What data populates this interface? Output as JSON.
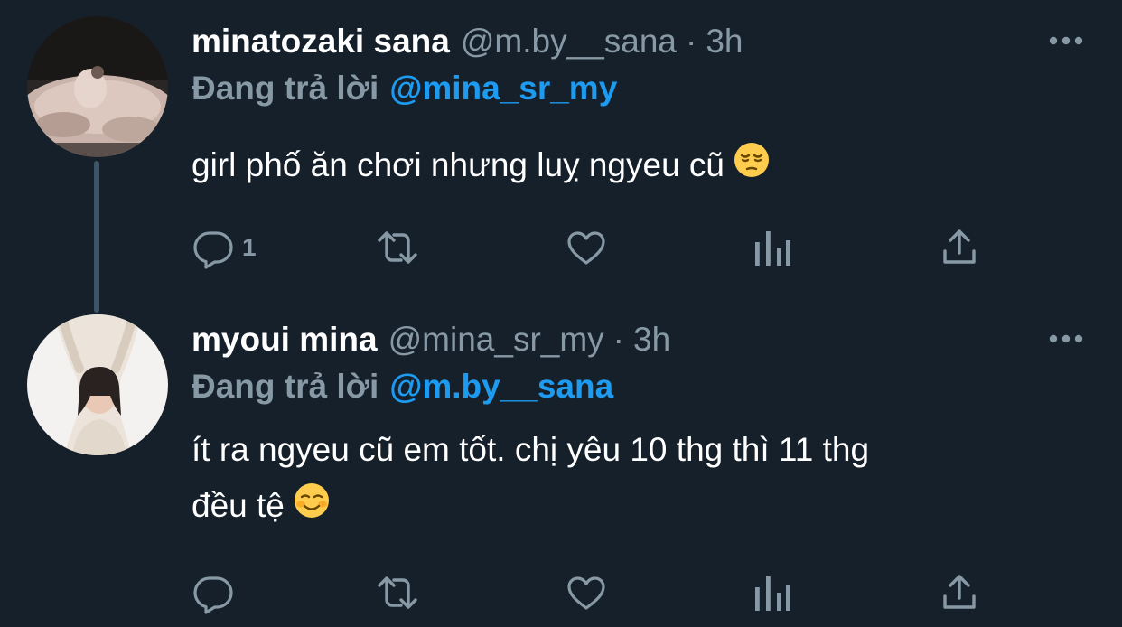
{
  "tweets": [
    {
      "display_name": "minatozaki sana",
      "handle": "@m.by__sana",
      "separator": "·",
      "time": "3h",
      "reply_prefix": "Đang trả lời",
      "reply_mention": "@mina_sr_my",
      "text": "girl phố ăn chơi nhưng luỵ ngyeu cũ",
      "emoji": "pensive-face",
      "reply_count": "1",
      "avatar": "photo-woman-in-ballgown"
    },
    {
      "display_name": "myoui mina",
      "handle": "@mina_sr_my",
      "separator": "·",
      "time": "3h",
      "reply_prefix": "Đang trả lời",
      "reply_mention": "@m.by__sana",
      "text_line1": "ít ra ngyeu cũ em tốt. chị yêu 10 thg thì 11 thg",
      "text_line2": "đều tệ",
      "emoji": "smiling-face",
      "reply_count": "",
      "avatar": "photo-woman-white-sweater"
    }
  ],
  "icons": {
    "reply": "reply-icon",
    "retweet": "retweet-icon",
    "like": "heart-icon",
    "analytics": "analytics-icon",
    "share": "share-icon",
    "more": "more-icon"
  },
  "colors": {
    "background": "#15202b",
    "secondary_text": "#8899a6",
    "link": "#1d9bf0",
    "thread_line": "#3d5466",
    "emoji_yellow": "#ffcc4d"
  }
}
